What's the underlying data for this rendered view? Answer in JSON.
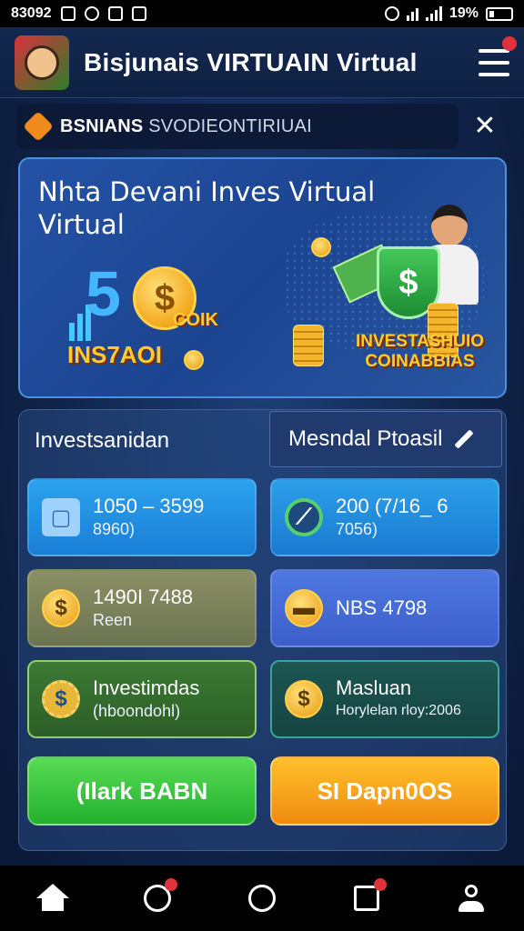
{
  "status_bar": {
    "time": "83092",
    "battery": "19%"
  },
  "header": {
    "title": "Bisjunais VIRTUAIN Virtual"
  },
  "notice": {
    "text_bold": "BSNIANS",
    "text": "SVODIEONTIRIUAI",
    "close_label": "✕"
  },
  "banner": {
    "title": "Nhta Devani Inves Virtual Virtual",
    "number": "5",
    "coin_symbol": "$",
    "promo_left_main": "INS7AOI",
    "promo_left_side": "COIK",
    "shield_symbol": "$",
    "promo_right": "INVESTASHUIO COINABBIAS"
  },
  "panel": {
    "label_left": "Investsanidan",
    "tab_right": "Mesndal Ptoasil"
  },
  "cards": [
    {
      "icon": "▢",
      "main": "1050 – 3599",
      "sub": "8960)"
    },
    {
      "icon": "⟋",
      "main": "200  (7/16_ 6",
      "sub": "7056)"
    },
    {
      "icon": "$",
      "main": "1490I 7488",
      "sub": "Reen"
    },
    {
      "icon": "▬",
      "main": "NBS 4798",
      "sub": ""
    },
    {
      "icon": "$",
      "main": "Investimdas",
      "sub": "(hboondohl)"
    },
    {
      "icon": "$",
      "main": "Masluan",
      "sub": "Horylelan rloy:2006"
    }
  ],
  "buttons": {
    "left": "(Ilark BABN",
    "right": "SI Dapn0OS"
  },
  "colors": {
    "accent_blue": "#2ca2ee",
    "accent_green": "#23b02e",
    "accent_orange": "#f08b10",
    "badge_red": "#e0323a"
  }
}
